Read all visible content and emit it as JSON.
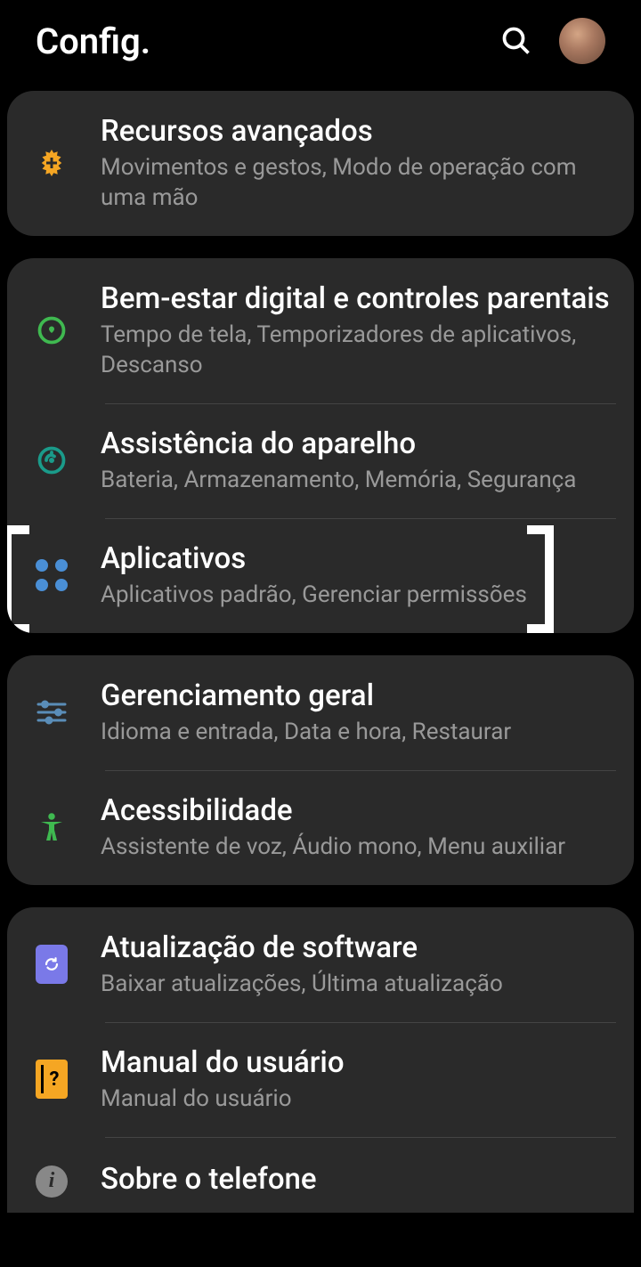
{
  "header": {
    "title": "Config."
  },
  "groups": [
    {
      "items": [
        {
          "id": "advanced-features",
          "icon": "gear-plus-icon",
          "title": "Recursos avançados",
          "subtitle": "Movimentos e gestos, Modo de operação com uma mão"
        }
      ]
    },
    {
      "items": [
        {
          "id": "digital-wellbeing",
          "icon": "wellbeing-icon",
          "title": "Bem-estar digital e controles parentais",
          "subtitle": "Tempo de tela, Temporizadores de aplicativos, Descanso"
        },
        {
          "id": "device-care",
          "icon": "device-care-icon",
          "title": "Assistência do aparelho",
          "subtitle": "Bateria, Armazenamento, Memória, Segurança"
        },
        {
          "id": "apps",
          "icon": "apps-icon",
          "title": "Aplicativos",
          "subtitle": "Aplicativos padrão, Gerenciar permissões",
          "highlighted": true
        }
      ]
    },
    {
      "items": [
        {
          "id": "general-management",
          "icon": "sliders-icon",
          "title": "Gerenciamento geral",
          "subtitle": "Idioma e entrada, Data e hora, Restaurar"
        },
        {
          "id": "accessibility",
          "icon": "accessibility-icon",
          "title": "Acessibilidade",
          "subtitle": "Assistente de voz, Áudio mono, Menu auxiliar"
        }
      ]
    },
    {
      "items": [
        {
          "id": "software-update",
          "icon": "update-icon",
          "title": "Atualização de software",
          "subtitle": "Baixar atualizações, Última atualização"
        },
        {
          "id": "user-manual",
          "icon": "manual-icon",
          "title": "Manual do usuário",
          "subtitle": "Manual do usuário"
        },
        {
          "id": "about-phone",
          "icon": "info-icon",
          "title": "Sobre o telefone",
          "subtitle": ""
        }
      ]
    }
  ]
}
